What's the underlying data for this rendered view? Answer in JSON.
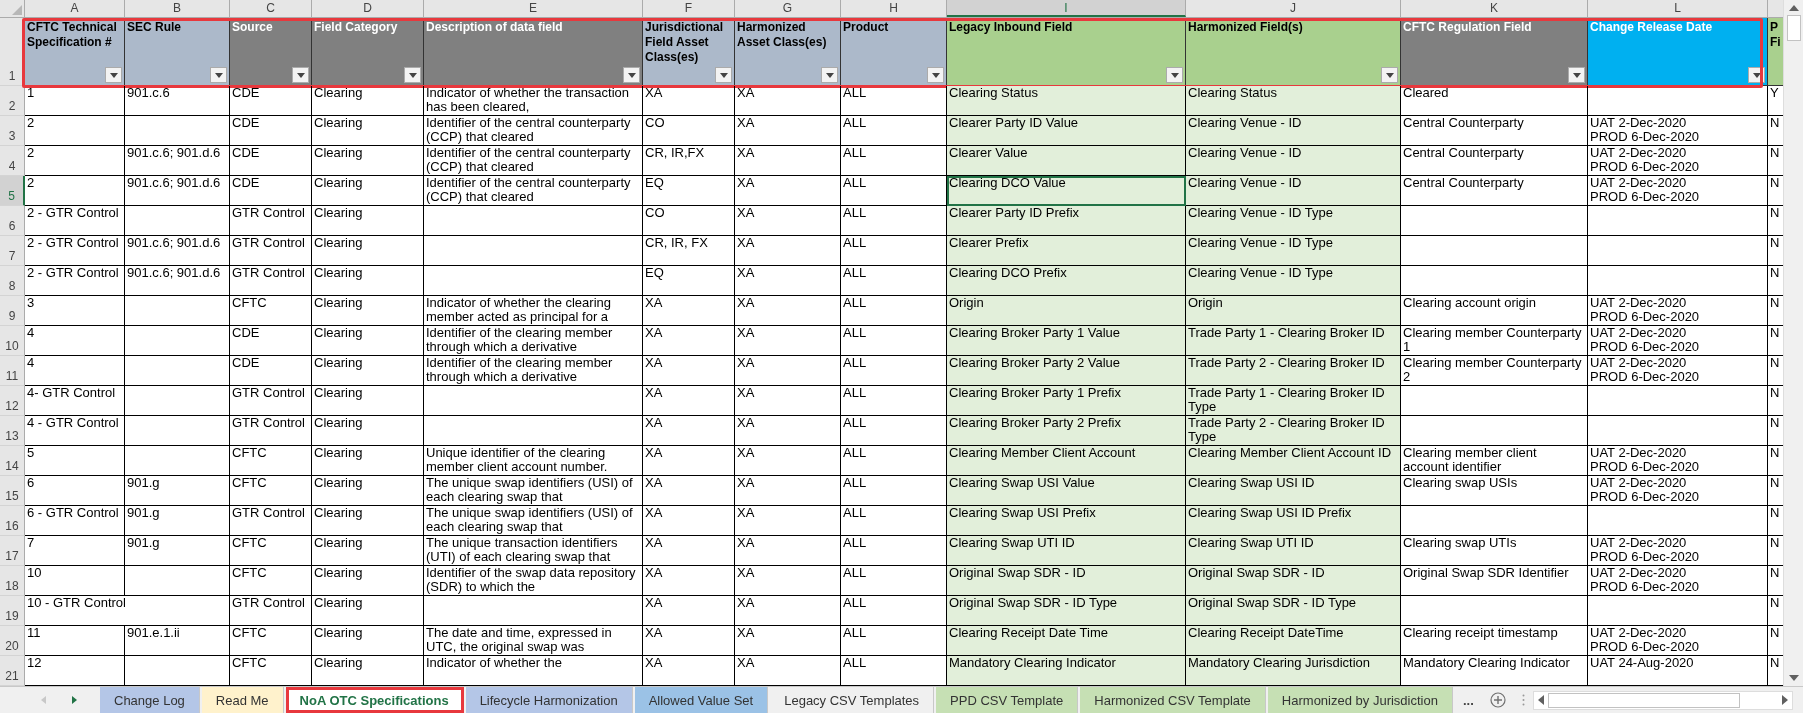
{
  "columns": [
    {
      "letter": "A",
      "selected": false,
      "heading": "CFTC Technical Specification #",
      "color": "#acb9ca",
      "shaded": false,
      "filter": true
    },
    {
      "letter": "B",
      "selected": false,
      "heading": "SEC Rule",
      "color": "#acb9ca",
      "shaded": false,
      "filter": true
    },
    {
      "letter": "C",
      "selected": false,
      "heading": "Source",
      "color": "#808080",
      "shaded": false,
      "filter": true
    },
    {
      "letter": "D",
      "selected": false,
      "heading": "Field Category",
      "color": "#808080",
      "shaded": false,
      "filter": true
    },
    {
      "letter": "E",
      "selected": false,
      "heading": "Description of data field",
      "color": "#808080",
      "shaded": false,
      "filter": true
    },
    {
      "letter": "F",
      "selected": false,
      "heading": "Jurisdictional Field Asset Class(es)",
      "color": "#acb9ca",
      "shaded": false,
      "filter": true
    },
    {
      "letter": "G",
      "selected": false,
      "heading": "Harmonized Asset Class(es)",
      "color": "#acb9ca",
      "shaded": false,
      "filter": true
    },
    {
      "letter": "H",
      "selected": false,
      "heading": "Product",
      "color": "#acb9ca",
      "shaded": false,
      "filter": true
    },
    {
      "letter": "I",
      "selected": true,
      "heading": "Legacy Inbound Field",
      "color": "#a9d08e",
      "shaded": true,
      "filter": true
    },
    {
      "letter": "J",
      "selected": false,
      "heading": "Harmonized Field(s)",
      "color": "#a9d08e",
      "shaded": true,
      "filter": true
    },
    {
      "letter": "K",
      "selected": false,
      "heading": "CFTC Regulation Field",
      "color": "#808080",
      "shaded": false,
      "filter": true
    },
    {
      "letter": "L",
      "selected": false,
      "heading": "Change Release Date",
      "color": "#00b0f0",
      "shaded": false,
      "filter": true
    },
    {
      "selected": false,
      "heading": "P Fi",
      "color": "#a9d08e",
      "shaded": false,
      "filter": false
    }
  ],
  "header_row": {
    "row_number": "1",
    "selected": false,
    "highlighted": true
  },
  "rows": [
    {
      "row_number": "2",
      "selected": false,
      "cells": [
        "1",
        "901.c.6",
        "CDE",
        "Clearing",
        "Indicator of whether the transaction has been cleared,",
        "XA",
        "XA",
        "ALL",
        "Clearing Status",
        "Clearing Status",
        "Cleared",
        "",
        "Y"
      ]
    },
    {
      "row_number": "3",
      "selected": false,
      "cells": [
        "2",
        "",
        "CDE",
        "Clearing",
        "Identifier of the central counterparty (CCP) that cleared",
        "CO",
        "XA",
        "ALL",
        "Clearer Party ID Value",
        "Clearing Venue - ID",
        "Central Counterparty",
        "UAT 2-Dec-2020\nPROD 6-Dec-2020",
        "N"
      ]
    },
    {
      "row_number": "4",
      "selected": false,
      "cells": [
        "2",
        "901.c.6; 901.d.6",
        "CDE",
        "Clearing",
        "Identifier of the central counterparty (CCP) that cleared",
        "CR, IR,FX",
        "XA",
        "ALL",
        "Clearer Value",
        "Clearing Venue - ID",
        "Central Counterparty",
        "UAT 2-Dec-2020\nPROD 6-Dec-2020",
        "N"
      ]
    },
    {
      "row_number": "5",
      "selected": true,
      "cells": [
        "2",
        "901.c.6; 901.d.6",
        "CDE",
        "Clearing",
        "Identifier of the central counterparty (CCP) that cleared",
        "EQ",
        "XA",
        "ALL",
        "Clearing DCO Value",
        "Clearing Venue - ID",
        "Central Counterparty",
        "UAT 2-Dec-2020\nPROD 6-Dec-2020",
        "N"
      ]
    },
    {
      "row_number": "6",
      "selected": false,
      "cells": [
        "2 - GTR Control",
        "",
        "GTR Control",
        "Clearing",
        "",
        "CO",
        "XA",
        "ALL",
        "Clearer Party ID Prefix",
        "Clearing Venue - ID Type",
        "",
        "",
        "N"
      ]
    },
    {
      "row_number": "7",
      "selected": false,
      "cells": [
        "2 - GTR Control",
        "901.c.6; 901.d.6",
        "GTR Control",
        "Clearing",
        "",
        "CR, IR, FX",
        "XA",
        "ALL",
        "Clearer Prefix",
        "Clearing Venue - ID Type",
        "",
        "",
        "N"
      ]
    },
    {
      "row_number": "8",
      "selected": false,
      "cells": [
        "2 - GTR Control",
        "901.c.6; 901.d.6",
        "GTR Control",
        "Clearing",
        "",
        "EQ",
        "XA",
        "ALL",
        "Clearing DCO Prefix",
        "Clearing Venue - ID Type",
        "",
        "",
        "N"
      ]
    },
    {
      "row_number": "9",
      "selected": false,
      "cells": [
        "3",
        "",
        "CFTC",
        "Clearing",
        "Indicator of whether the clearing member acted as principal for a",
        "XA",
        "XA",
        "ALL",
        "Origin",
        "Origin",
        "Clearing account origin",
        "UAT 2-Dec-2020\nPROD 6-Dec-2020",
        "N"
      ]
    },
    {
      "row_number": "10",
      "selected": false,
      "cells": [
        "4",
        "",
        "CDE",
        "Clearing",
        "Identifier of the clearing member through which a derivative",
        "XA",
        "XA",
        "ALL",
        "Clearing Broker Party 1 Value",
        "Trade Party 1 - Clearing Broker ID",
        "Clearing member Counterparty 1",
        "UAT 2-Dec-2020\nPROD 6-Dec-2020",
        "N"
      ]
    },
    {
      "row_number": "11",
      "selected": false,
      "cells": [
        "4",
        "",
        "CDE",
        "Clearing",
        "Identifier of the clearing member through which a derivative",
        "XA",
        "XA",
        "ALL",
        "Clearing Broker Party 2 Value",
        "Trade Party 2 - Clearing Broker ID",
        "Clearing member Counterparty 2",
        "UAT 2-Dec-2020\nPROD 6-Dec-2020",
        "N"
      ]
    },
    {
      "row_number": "12",
      "selected": false,
      "cells": [
        "4- GTR Control",
        "",
        "GTR Control",
        "Clearing",
        "",
        "XA",
        "XA",
        "ALL",
        "Clearing Broker Party 1 Prefix",
        "Trade Party 1 - Clearing Broker ID Type",
        "",
        "",
        "N"
      ]
    },
    {
      "row_number": "13",
      "selected": false,
      "cells": [
        "4 - GTR Control",
        "",
        "GTR Control",
        "Clearing",
        "",
        "XA",
        "XA",
        "ALL",
        "Clearing Broker Party 2 Prefix",
        "Trade Party 2 - Clearing Broker ID Type",
        "",
        "",
        "N"
      ]
    },
    {
      "row_number": "14",
      "selected": false,
      "cells": [
        "5",
        "",
        "CFTC",
        "Clearing",
        "Unique identifier of the clearing member client account number.",
        "XA",
        "XA",
        "ALL",
        "Clearing Member Client Account",
        "Clearing Member Client Account ID",
        "Clearing member client account identifier",
        "UAT 2-Dec-2020\nPROD 6-Dec-2020",
        "N"
      ]
    },
    {
      "row_number": "15",
      "selected": false,
      "cells": [
        "6",
        "901.g",
        "CFTC",
        "Clearing",
        "The unique swap identifiers (USI) of each clearing swap that",
        "XA",
        "XA",
        "ALL",
        "Clearing Swap USI Value",
        "Clearing Swap USI ID",
        "Clearing swap USIs",
        "UAT 2-Dec-2020\nPROD 6-Dec-2020",
        "N"
      ]
    },
    {
      "row_number": "16",
      "selected": false,
      "cells": [
        "6 - GTR Control",
        "901.g",
        "GTR Control",
        "Clearing",
        "The unique swap identifiers (USI) of each clearing swap that",
        "XA",
        "XA",
        "ALL",
        "Clearing Swap USI Prefix",
        "Clearing Swap USI ID Prefix",
        "",
        "",
        "N"
      ]
    },
    {
      "row_number": "17",
      "selected": false,
      "cells": [
        "7",
        "901.g",
        "CFTC",
        "Clearing",
        "The unique transaction identifiers (UTI) of each clearing swap that",
        "XA",
        "XA",
        "ALL",
        "Clearing Swap UTI ID",
        "Clearing Swap UTI ID",
        "Clearing swap UTIs",
        "UAT 2-Dec-2020\nPROD 6-Dec-2020",
        "N"
      ]
    },
    {
      "row_number": "18",
      "selected": false,
      "cells": [
        "10",
        "",
        "CFTC",
        "Clearing",
        "Identifier of the swap data repository (SDR) to which the",
        "XA",
        "XA",
        "ALL",
        "Original Swap SDR - ID",
        "Original Swap SDR - ID",
        "Original Swap SDR Identifier",
        "UAT 2-Dec-2020\nPROD 6-Dec-2020",
        "N"
      ]
    },
    {
      "row_number": "19",
      "selected": false,
      "first_cell_spills": true,
      "cells": [
        "10 - GTR Control",
        "",
        "GTR Control",
        "Clearing",
        "",
        "XA",
        "XA",
        "ALL",
        "Original Swap SDR - ID Type",
        "Original Swap SDR - ID Type",
        "",
        "",
        "N"
      ]
    },
    {
      "row_number": "20",
      "selected": false,
      "cells": [
        "11",
        "901.e.1.ii",
        "CFTC",
        "Clearing",
        "The date and time, expressed in UTC, the original swap was",
        "XA",
        "XA",
        "ALL",
        "Clearing Receipt Date Time",
        "Clearing Receipt DateTime",
        "Clearing receipt timestamp",
        "UAT 2-Dec-2020\nPROD 6-Dec-2020",
        "N"
      ]
    },
    {
      "row_number": "21",
      "selected": false,
      "cells": [
        "12",
        "",
        "CFTC",
        "Clearing",
        "Indicator of whether the",
        "XA",
        "XA",
        "ALL",
        "Mandatory Clearing Indicator",
        "Mandatory Clearing Jurisdiction",
        "Mandatory Clearing Indicator",
        "UAT 24-Aug-2020",
        "N"
      ]
    }
  ],
  "sheet_tabs": [
    {
      "label": "Change Log",
      "selected": false,
      "highlighted": false,
      "color": "#b4c6e7"
    },
    {
      "label": "Read Me",
      "selected": false,
      "highlighted": false,
      "color": "#fff2cc"
    },
    {
      "label": "NoA OTC Specifications",
      "selected": true,
      "highlighted": true
    },
    {
      "label": "Lifecycle Harmonization",
      "selected": false,
      "highlighted": false,
      "color": "#b4c6e7"
    },
    {
      "label": "Allowed Value Set",
      "selected": false,
      "highlighted": false,
      "color": "#9bc2e6"
    },
    {
      "label": "Legacy CSV Templates",
      "selected": false,
      "highlighted": false
    },
    {
      "label": "PPD CSV Template",
      "selected": false,
      "highlighted": false,
      "color": "#c6e0b4"
    },
    {
      "label": "Harmonized CSV Template",
      "selected": false,
      "highlighted": false,
      "color": "#c6e0b4"
    },
    {
      "label": "Harmonized by Jurisdiction",
      "selected": false,
      "highlighted": false,
      "color": "#c6e0b4"
    }
  ],
  "more_tabs": "..."
}
